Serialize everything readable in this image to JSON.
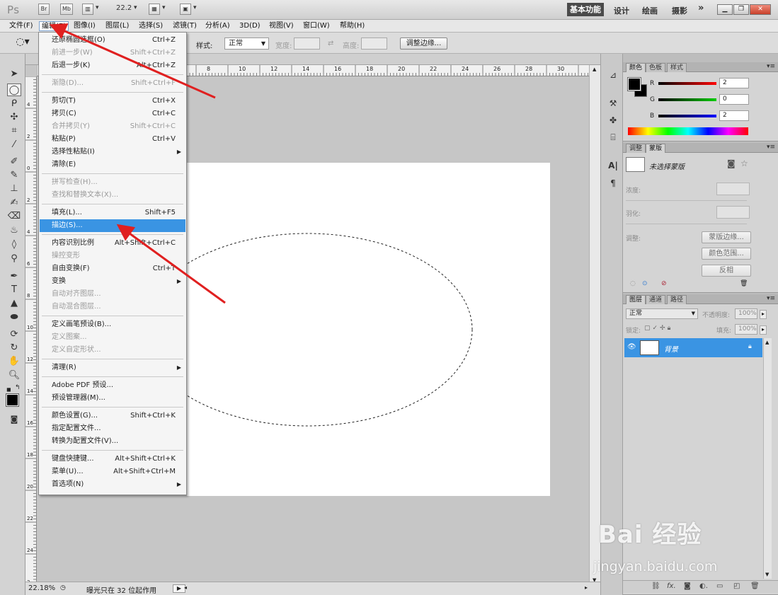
{
  "app": {
    "logo": "Ps",
    "bridge_label": "Br",
    "minibridge_label": "Mb",
    "zoom": "22.2",
    "workspaces": [
      "基本功能",
      "设计",
      "绘画",
      "摄影"
    ],
    "more": "»"
  },
  "menubar": [
    "文件(F)",
    "编辑(E)",
    "图像(I)",
    "图层(L)",
    "选择(S)",
    "滤镜(T)",
    "分析(A)",
    "3D(D)",
    "视图(V)",
    "窗口(W)",
    "帮助(H)"
  ],
  "options": {
    "style_label": "样式:",
    "style_value": "正常",
    "width_label": "宽度:",
    "height_label": "高度:",
    "refine_edge": "调整边缘..."
  },
  "ruler": {
    "h": [
      "8",
      "10",
      "12",
      "14",
      "16",
      "18",
      "20",
      "22",
      "24",
      "26",
      "28",
      "30",
      "32"
    ],
    "v": [
      "4",
      "2",
      "0",
      "2",
      "4",
      "6",
      "8",
      "10",
      "12",
      "14",
      "16",
      "18",
      "20",
      "22",
      "24",
      "2"
    ]
  },
  "edit_menu": [
    {
      "label": "还原椭圆选框(O)",
      "shortcut": "Ctrl+Z",
      "state": "normal"
    },
    {
      "label": "前进一步(W)",
      "shortcut": "Shift+Ctrl+Z",
      "state": "disabled"
    },
    {
      "label": "后退一步(K)",
      "shortcut": "Alt+Ctrl+Z",
      "state": "normal"
    },
    {
      "sep": true
    },
    {
      "label": "渐隐(D)...",
      "shortcut": "Shift+Ctrl+F",
      "state": "disabled"
    },
    {
      "sep": true
    },
    {
      "label": "剪切(T)",
      "shortcut": "Ctrl+X",
      "state": "normal"
    },
    {
      "label": "拷贝(C)",
      "shortcut": "Ctrl+C",
      "state": "normal"
    },
    {
      "label": "合并拷贝(Y)",
      "shortcut": "Shift+Ctrl+C",
      "state": "disabled"
    },
    {
      "label": "粘贴(P)",
      "shortcut": "Ctrl+V",
      "state": "normal"
    },
    {
      "label": "选择性粘贴(I)",
      "shortcut": "",
      "state": "normal",
      "submenu": true
    },
    {
      "label": "清除(E)",
      "shortcut": "",
      "state": "normal"
    },
    {
      "sep": true
    },
    {
      "label": "拼写检查(H)...",
      "shortcut": "",
      "state": "disabled"
    },
    {
      "label": "查找和替换文本(X)...",
      "shortcut": "",
      "state": "disabled"
    },
    {
      "sep": true
    },
    {
      "label": "填充(L)...",
      "shortcut": "Shift+F5",
      "state": "normal"
    },
    {
      "label": "描边(S)...",
      "shortcut": "",
      "state": "highlighted"
    },
    {
      "sep": true
    },
    {
      "label": "内容识别比例",
      "shortcut": "Alt+Shift+Ctrl+C",
      "state": "normal"
    },
    {
      "label": "操控变形",
      "shortcut": "",
      "state": "disabled"
    },
    {
      "label": "自由变换(F)",
      "shortcut": "Ctrl+T",
      "state": "normal"
    },
    {
      "label": "变换",
      "shortcut": "",
      "state": "normal",
      "submenu": true
    },
    {
      "label": "自动对齐图层...",
      "shortcut": "",
      "state": "disabled"
    },
    {
      "label": "自动混合图层...",
      "shortcut": "",
      "state": "disabled"
    },
    {
      "sep": true
    },
    {
      "label": "定义画笔预设(B)...",
      "shortcut": "",
      "state": "normal"
    },
    {
      "label": "定义图案...",
      "shortcut": "",
      "state": "disabled"
    },
    {
      "label": "定义自定形状...",
      "shortcut": "",
      "state": "disabled"
    },
    {
      "sep": true
    },
    {
      "label": "清理(R)",
      "shortcut": "",
      "state": "normal",
      "submenu": true
    },
    {
      "sep": true
    },
    {
      "label": "Adobe PDF 预设...",
      "shortcut": "",
      "state": "normal"
    },
    {
      "label": "预设管理器(M)...",
      "shortcut": "",
      "state": "normal"
    },
    {
      "sep": true
    },
    {
      "label": "颜色设置(G)...",
      "shortcut": "Shift+Ctrl+K",
      "state": "normal"
    },
    {
      "label": "指定配置文件...",
      "shortcut": "",
      "state": "normal"
    },
    {
      "label": "转换为配置文件(V)...",
      "shortcut": "",
      "state": "normal"
    },
    {
      "sep": true
    },
    {
      "label": "键盘快捷键...",
      "shortcut": "Alt+Shift+Ctrl+K",
      "state": "normal"
    },
    {
      "label": "菜单(U)...",
      "shortcut": "Alt+Shift+Ctrl+M",
      "state": "normal"
    },
    {
      "label": "首选项(N)",
      "shortcut": "",
      "state": "normal",
      "submenu": true
    }
  ],
  "status": {
    "zoom": "22.18%",
    "info": "曝光只在 32 位起作用"
  },
  "color_panel": {
    "tabs": [
      "颜色",
      "色板",
      "样式"
    ],
    "channels": [
      {
        "name": "R",
        "value": "2",
        "gradient": "#d31818"
      },
      {
        "name": "G",
        "value": "0",
        "gradient": "#1a9b1a"
      },
      {
        "name": "B",
        "value": "2",
        "gradient": "#1a1ab8"
      }
    ]
  },
  "masks_panel": {
    "tabs": [
      "调整",
      "蒙版"
    ],
    "no_mask": "未选择蒙版",
    "density": "浓度:",
    "feather": "羽化:",
    "refine": "调整:",
    "btn_mask_edge": "蒙版边缘...",
    "btn_color_range": "颜色范围...",
    "btn_invert": "反相"
  },
  "layers_panel": {
    "tabs": [
      "图层",
      "通道",
      "路径"
    ],
    "blend_mode": "正常",
    "opacity_label": "不透明度:",
    "opacity": "100%",
    "lock_label": "锁定:",
    "fill_label": "填充:",
    "fill": "100%",
    "layer_name": "背景"
  },
  "watermark": {
    "logo": "Bai 经验",
    "url": "jingyan.baidu.com"
  },
  "colors": {
    "highlight": "#3a94e3",
    "arrow": "#e02020",
    "layer_selected": "#3a94e3"
  }
}
